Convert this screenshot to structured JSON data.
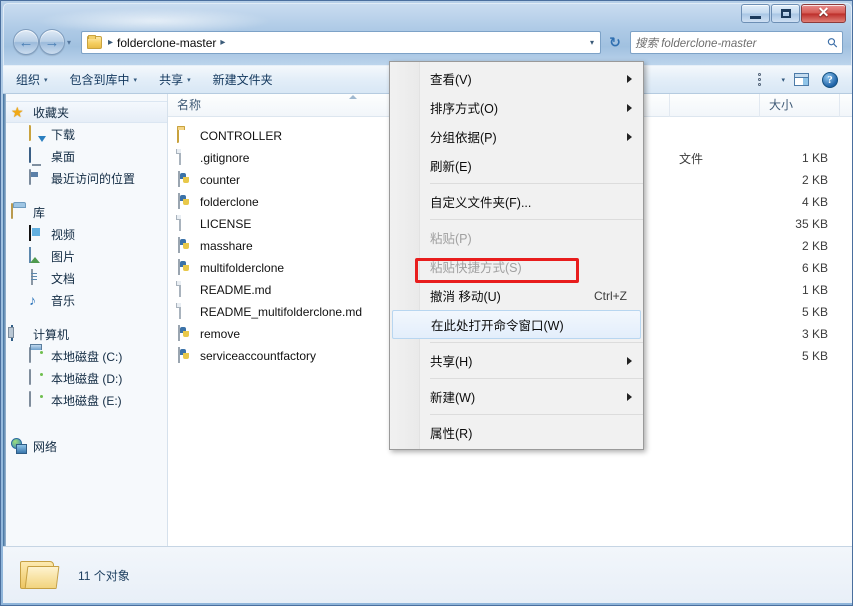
{
  "window": {
    "minimize_label": "–",
    "maximize_label": "□",
    "close_label": "✕"
  },
  "navbar": {
    "back_label": "←",
    "forward_label": "→",
    "history_label": "▾",
    "breadcrumb_sep": "▸",
    "breadcrumb_folder": "folderclone-master",
    "address_dropdown": "▾",
    "refresh_label": "↻",
    "search_placeholder": "搜索 folderclone-master",
    "search_icon": "⚲"
  },
  "commandbar": {
    "items": [
      {
        "label": "组织",
        "caret": "▾"
      },
      {
        "label": "包含到库中",
        "caret": "▾"
      },
      {
        "label": "共享",
        "caret": "▾"
      },
      {
        "label": "新建文件夹",
        "caret": ""
      }
    ],
    "view_caret": "▾",
    "help_label": "?"
  },
  "sidebar": {
    "groups": [
      {
        "root": {
          "label": "收藏夹",
          "icon": "star-icon",
          "selected": true
        },
        "children": [
          {
            "label": "下载",
            "icon": "downloads-icon"
          },
          {
            "label": "桌面",
            "icon": "desktop-icon"
          },
          {
            "label": "最近访问的位置",
            "icon": "recent-places-icon"
          }
        ]
      },
      {
        "root": {
          "label": "库",
          "icon": "library-icon",
          "selected": false
        },
        "children": [
          {
            "label": "视频",
            "icon": "video-icon"
          },
          {
            "label": "图片",
            "icon": "pictures-icon"
          },
          {
            "label": "文档",
            "icon": "documents-icon"
          },
          {
            "label": "音乐",
            "icon": "music-icon"
          }
        ]
      },
      {
        "root": {
          "label": "计算机",
          "icon": "computer-icon",
          "selected": false
        },
        "children": [
          {
            "label": "本地磁盘 (C:)",
            "icon": "system-drive-icon"
          },
          {
            "label": "本地磁盘 (D:)",
            "icon": "drive-icon"
          },
          {
            "label": "本地磁盘 (E:)",
            "icon": "drive-icon"
          }
        ]
      },
      {
        "root": {
          "label": "网络",
          "icon": "network-icon",
          "selected": false
        },
        "children": []
      }
    ]
  },
  "filelist": {
    "columns": [
      {
        "key": "name",
        "label": "名称",
        "sorted": true
      },
      {
        "key": "date",
        "label": ""
      },
      {
        "key": "type",
        "label": ""
      },
      {
        "key": "size",
        "label": "大小"
      },
      {
        "key": "rest",
        "label": ""
      }
    ],
    "rows": [
      {
        "name": "CONTROLLER",
        "icon": "folder-icon",
        "date": "",
        "type": "",
        "size": ""
      },
      {
        "name": ".gitignore",
        "icon": "file-icon",
        "date": "",
        "type": "文件",
        "size": "1 KB"
      },
      {
        "name": "counter",
        "icon": "python-icon",
        "date": "",
        "type": "",
        "size": "2 KB"
      },
      {
        "name": "folderclone",
        "icon": "python-icon",
        "date": "",
        "type": "",
        "size": "4 KB"
      },
      {
        "name": "LICENSE",
        "icon": "file-icon",
        "date": "",
        "type": "",
        "size": "35 KB"
      },
      {
        "name": "masshare",
        "icon": "python-icon",
        "date": "",
        "type": "",
        "size": "2 KB"
      },
      {
        "name": "multifolderclone",
        "icon": "python-icon",
        "date": "",
        "type": "",
        "size": "6 KB"
      },
      {
        "name": "README.md",
        "icon": "file-icon",
        "date": "",
        "type": "",
        "size": "1 KB"
      },
      {
        "name": "README_multifolderclone.md",
        "icon": "file-icon",
        "date": "",
        "type": "",
        "size": "5 KB"
      },
      {
        "name": "remove",
        "icon": "python-icon",
        "date": "",
        "type": "",
        "size": "3 KB"
      },
      {
        "name": "serviceaccountfactory",
        "icon": "python-icon",
        "date": "",
        "type": "",
        "size": "5 KB"
      }
    ]
  },
  "details": {
    "status_text": "11 个对象",
    "folder_icon": "folder-icon"
  },
  "contextmenu": {
    "items": [
      {
        "label": "查看(V)",
        "accel": "",
        "submenu": true,
        "disabled": false,
        "highlighted": false,
        "sep_after": false
      },
      {
        "label": "排序方式(O)",
        "accel": "",
        "submenu": true,
        "disabled": false,
        "highlighted": false,
        "sep_after": false
      },
      {
        "label": "分组依据(P)",
        "accel": "",
        "submenu": true,
        "disabled": false,
        "highlighted": false,
        "sep_after": false
      },
      {
        "label": "刷新(E)",
        "accel": "",
        "submenu": false,
        "disabled": false,
        "highlighted": false,
        "sep_after": true
      },
      {
        "label": "自定义文件夹(F)...",
        "accel": "",
        "submenu": false,
        "disabled": false,
        "highlighted": false,
        "sep_after": true
      },
      {
        "label": "粘贴(P)",
        "accel": "",
        "submenu": false,
        "disabled": true,
        "highlighted": false,
        "sep_after": false
      },
      {
        "label": "粘贴快捷方式(S)",
        "accel": "",
        "submenu": false,
        "disabled": true,
        "highlighted": false,
        "sep_after": false
      },
      {
        "label": "撤消 移动(U)",
        "accel": "Ctrl+Z",
        "submenu": false,
        "disabled": false,
        "highlighted": false,
        "sep_after": false
      },
      {
        "label": "在此处打开命令窗口(W)",
        "accel": "",
        "submenu": false,
        "disabled": false,
        "highlighted": true,
        "sep_after": true
      },
      {
        "label": "共享(H)",
        "accel": "",
        "submenu": true,
        "disabled": false,
        "highlighted": false,
        "sep_after": true
      },
      {
        "label": "新建(W)",
        "accel": "",
        "submenu": true,
        "disabled": false,
        "highlighted": false,
        "sep_after": true
      },
      {
        "label": "属性(R)",
        "accel": "",
        "submenu": false,
        "disabled": false,
        "highlighted": false,
        "sep_after": false
      }
    ],
    "highlight_color": "#e81d1d"
  }
}
